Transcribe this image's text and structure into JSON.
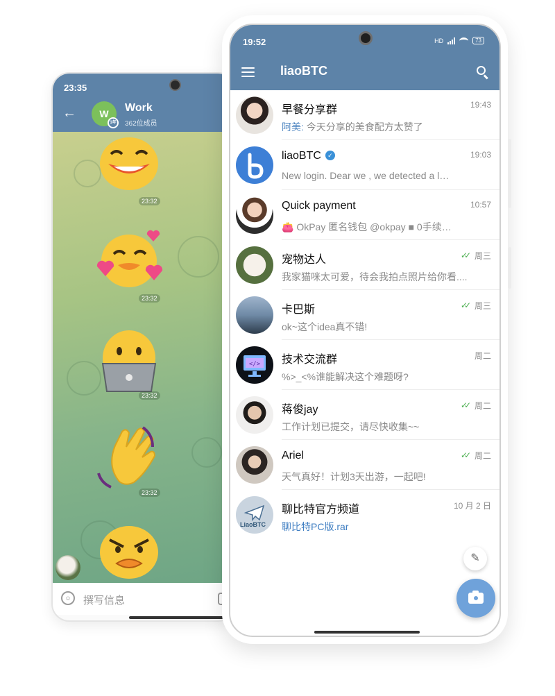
{
  "back_phone": {
    "status_time": "23:35",
    "back_icon": "arrow-left-icon",
    "group_avatar_letter": "W",
    "group_avatar_badge": "1年",
    "group_title": "Work",
    "group_subtitle": "362位成员",
    "sticker_times": [
      "23:32",
      "23:32",
      "23:32",
      "23:32"
    ],
    "input_placeholder": "撰写信息",
    "colors": {
      "header": "#5d83a8",
      "avatar": "#7cc05b"
    }
  },
  "front_phone": {
    "status_time": "19:52",
    "status_network": "HD",
    "battery_level": "73",
    "app_title": "liaoBTC",
    "menu_icon": "hamburger-menu-icon",
    "search_icon": "search-icon",
    "colors": {
      "header": "#5d83a8",
      "link": "#4f86c1",
      "read_ticks": "#4caf50",
      "fab": "#6fa2da"
    },
    "chats": [
      {
        "name": "早餐分享群",
        "time": "19:43",
        "sender": "阿美:",
        "message": " 今天分享的美食配方太赞了",
        "read": false
      },
      {
        "name": "liaoBTC",
        "verified": true,
        "time": "19:03",
        "sender": "",
        "message": "New login. Dear  we , we detected a l…",
        "read": false
      },
      {
        "name": "Quick payment",
        "time": "10:57",
        "sender": "",
        "message": "👛 OkPay 匿名钱包 @okpay ■ 0手续…",
        "read": false
      },
      {
        "name": "宠物达人",
        "time": "周三",
        "sender": "",
        "message": "我家猫咪太可爱，待会我拍点照片给你看....",
        "read": true
      },
      {
        "name": "卡巴斯",
        "time": "周三",
        "sender": "",
        "message": " ok~这个idea真不错!",
        "read": true
      },
      {
        "name": "技术交流群",
        "time": "周二",
        "sender": "",
        "message": "%>_<%谁能解决这个难题呀?",
        "read": false
      },
      {
        "name": "蒋俊jay",
        "time": "周二",
        "sender": "",
        "message": "工作计划已提交，请尽快收集~~",
        "read": true
      },
      {
        "name": "Ariel",
        "time": "周二",
        "sender": "",
        "message": "天气真好！计划3天出游，一起吧!",
        "read": true
      },
      {
        "name": "聊比特官方频道",
        "time": "10 月 2 日",
        "sender": "",
        "message": "聊比特PC版.rar",
        "read": false,
        "link": true
      }
    ],
    "channel_avatar_label": "LiaoBTC",
    "read_ticks_glyph": "✓✓",
    "fab_pencil_icon": "pencil-icon",
    "fab_camera_icon": "camera-icon"
  }
}
